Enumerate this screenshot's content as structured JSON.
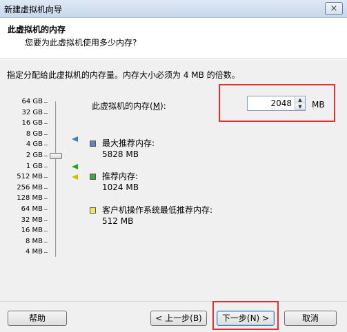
{
  "window": {
    "title": "新建虚拟机向导",
    "close_glyph": "×"
  },
  "header": {
    "title": "此虚拟机的内存",
    "subtitle": "您要为此虚拟机使用多少内存?"
  },
  "instruction": "指定分配给此虚拟机的内存量。内存大小必须为 4 MB 的倍数。",
  "memory": {
    "label_prefix": "此虚拟机的内存(",
    "label_key": "M",
    "label_suffix": "):",
    "value": "2048",
    "unit": "MB",
    "up_glyph": "▲",
    "down_glyph": "▼"
  },
  "scale_labels": [
    "64 GB",
    "32 GB",
    "16 GB",
    "8 GB",
    "4 GB",
    "2 GB",
    "1 GB",
    "512 MB",
    "256 MB",
    "128 MB",
    "64 MB",
    "32 MB",
    "16 MB",
    "8 MB",
    "4 MB"
  ],
  "legend": [
    {
      "title": "最大推荐内存:",
      "value": "5828 MB",
      "color": "#5b87c8"
    },
    {
      "title": "推荐内存:",
      "value": "1024 MB",
      "color": "#33b033"
    },
    {
      "title": "客户机操作系统最低推荐内存:",
      "value": "512 MB",
      "color": "#f0ec40"
    }
  ],
  "buttons": {
    "help": "帮助",
    "back": "< 上一步(B)",
    "next": "下一步(N) >",
    "cancel": "取消"
  }
}
